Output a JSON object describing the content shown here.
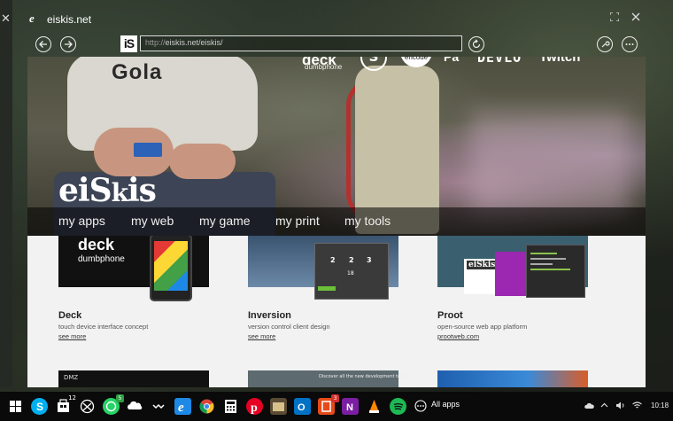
{
  "window": {
    "title": "eiskis.net",
    "maximize_icon": "maximize-icon",
    "close_icon": "close-icon"
  },
  "left_window": {
    "close_glyph": "✕"
  },
  "navbar": {
    "back_icon": "back-arrow-icon",
    "forward_icon": "forward-arrow-icon",
    "site_logo": "iS",
    "url_prefix": "http://",
    "url_body": "eiskis.net/eiskis/",
    "refresh_icon": "refresh-icon",
    "settings_icon": "wrench-icon",
    "more_icon": "more-icon"
  },
  "hero": {
    "shirt_text": "Gola",
    "top_links": {
      "deck": "deck",
      "dumbphone": "dumbphone",
      "s_logo": "S",
      "encode": "encode",
      "pa": "Pa",
      "devlo": "DEVLO",
      "twitch": "Twitch"
    },
    "brand_a": "eiS",
    "brand_b": "k",
    "brand_c": "is",
    "menu": [
      "my apps",
      "my web",
      "my game",
      "my print",
      "my tools"
    ]
  },
  "cards": [
    {
      "title": "Deck",
      "desc": "touch device interface concept",
      "link": "see more",
      "thumb_deck": "deck",
      "thumb_dumb": "dumbphone"
    },
    {
      "title": "Inversion",
      "desc": "version control client design",
      "link": "see more",
      "thumb_nums": [
        "2",
        "2",
        "3"
      ],
      "thumb_num2": "18"
    },
    {
      "title": "Proot",
      "desc": "open-source web app platform",
      "link": "prootweb.com",
      "thumb_logo": "eiSkis"
    }
  ],
  "row2": {
    "dmz": "DMZ",
    "second_text": "Discover all the new development tools"
  },
  "taskbar": {
    "items": [
      {
        "name": "windows-start-icon"
      },
      {
        "name": "skype-icon"
      },
      {
        "name": "store-icon",
        "badge": "12"
      },
      {
        "name": "xbox-icon"
      },
      {
        "name": "whatsapp-icon",
        "badge": "5"
      },
      {
        "name": "onedrive-icon"
      },
      {
        "name": "tidal-icon"
      },
      {
        "name": "edge-icon"
      },
      {
        "name": "chrome-icon"
      },
      {
        "name": "calculator-icon"
      },
      {
        "name": "pinterest-icon"
      },
      {
        "name": "notepad-icon"
      },
      {
        "name": "outlook-icon"
      },
      {
        "name": "office-icon",
        "badge": "3"
      },
      {
        "name": "onenote-icon"
      },
      {
        "name": "vlc-icon"
      },
      {
        "name": "spotify-icon"
      }
    ],
    "all_apps": "All apps",
    "clock": "10:18"
  },
  "colors": {
    "accent": "#2e8bd6",
    "brand_red": "#d32f2f"
  }
}
